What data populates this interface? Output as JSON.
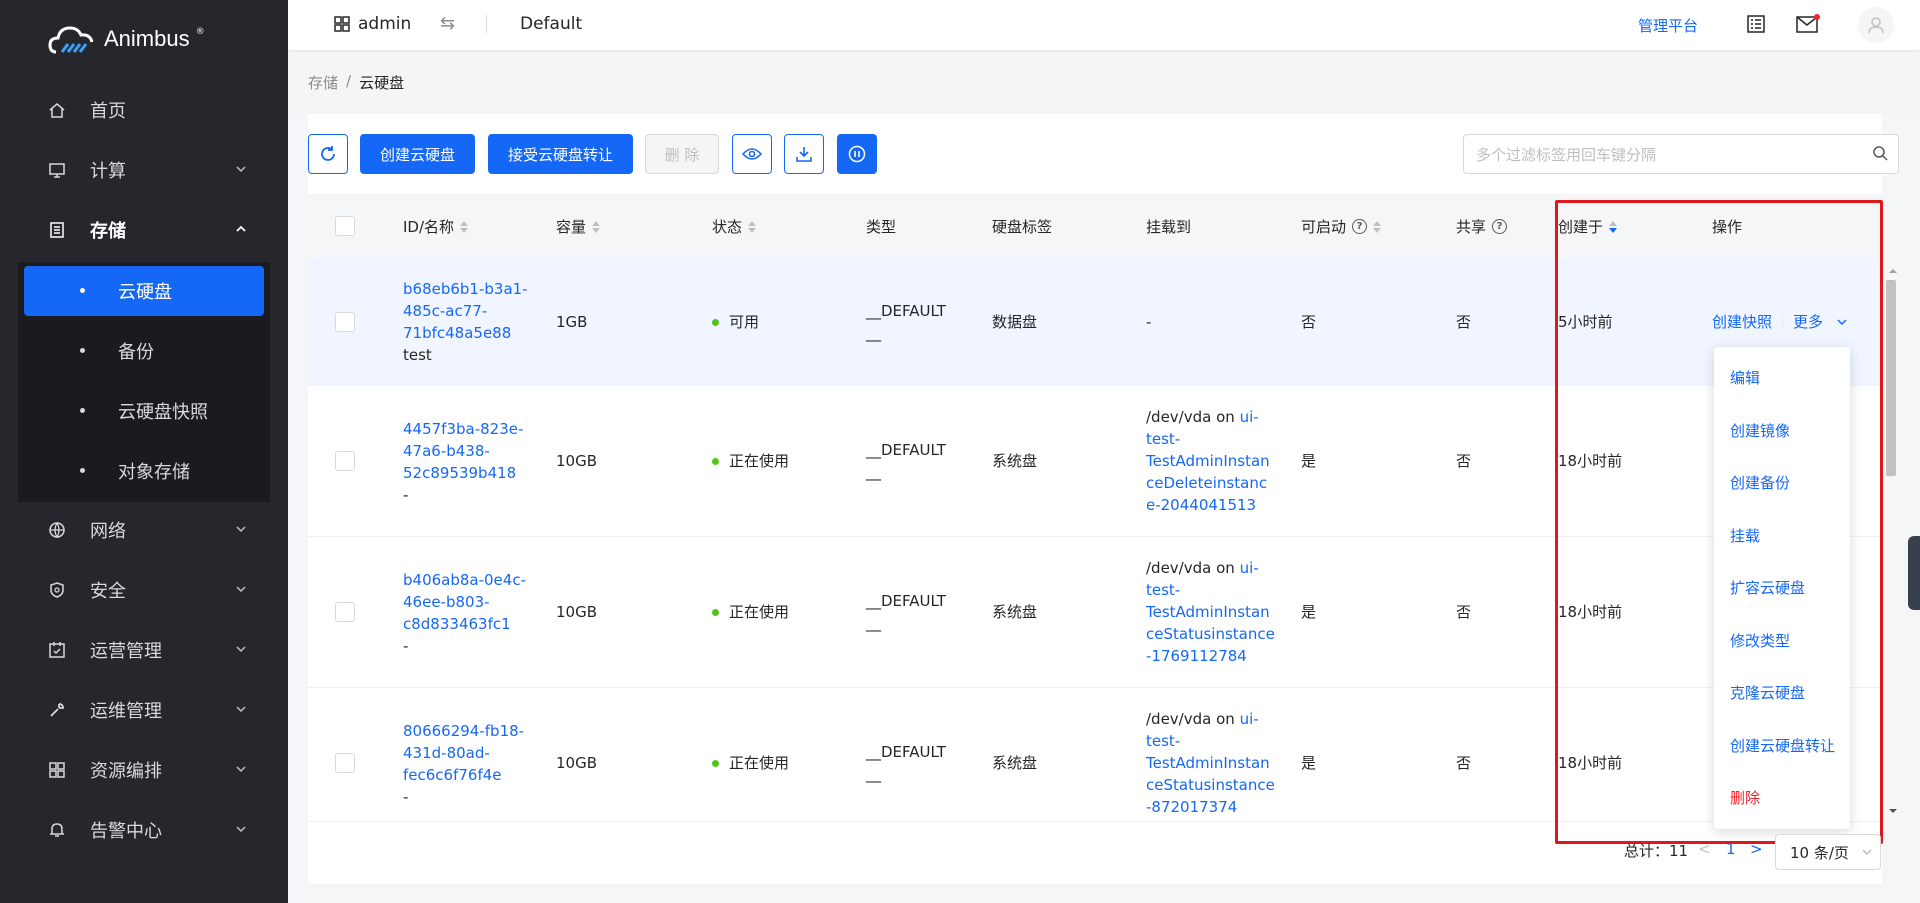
{
  "app": {
    "logo_text": "Animbus",
    "logo_mark": "®"
  },
  "sidebar": {
    "items": [
      {
        "label": "首页",
        "icon": "home-icon"
      },
      {
        "label": "计算",
        "icon": "monitor-icon"
      },
      {
        "label": "存储",
        "icon": "storage-icon"
      },
      {
        "label": "网络",
        "icon": "globe-icon"
      },
      {
        "label": "安全",
        "icon": "shield-icon"
      },
      {
        "label": "运营管理",
        "icon": "calendar-icon"
      },
      {
        "label": "运维管理",
        "icon": "wrench-icon"
      },
      {
        "label": "资源编排",
        "icon": "grid-icon"
      },
      {
        "label": "告警中心",
        "icon": "bell-icon"
      }
    ],
    "storage_sub": [
      {
        "label": "云硬盘"
      },
      {
        "label": "备份"
      },
      {
        "label": "云硬盘快照"
      },
      {
        "label": "对象存储"
      }
    ]
  },
  "header": {
    "project": "admin",
    "domain": "Default",
    "admin_link": "管理平台"
  },
  "breadcrumb": {
    "parent": "存储",
    "sep": "/",
    "current": "云硬盘"
  },
  "toolbar": {
    "create_label": "创建云硬盘",
    "accept_transfer_label": "接受云硬盘转让",
    "delete_label": "删 除",
    "search_placeholder": "多个过滤标签用回车键分隔"
  },
  "table": {
    "columns": {
      "id_name": "ID/名称",
      "size": "容量",
      "status": "状态",
      "type": "类型",
      "tag": "硬盘标签",
      "attached": "挂载到",
      "bootable": "可启动",
      "shared": "共享",
      "created": "创建于",
      "actions": "操作"
    },
    "rows": [
      {
        "id_lines": [
          "b68eb6b1-b3a1-",
          "485c-ac77-",
          "71bfc48a5e88"
        ],
        "name": "test",
        "size": "1GB",
        "status": "可用",
        "type_line1": "__DEFAULT",
        "type_line2": "__",
        "tag": "数据盘",
        "attached_dev": "-",
        "attached_lines": [],
        "bootable": "否",
        "shared": "否",
        "created": "5小时前",
        "action_snapshot": "创建快照",
        "action_more": "更多"
      },
      {
        "id_lines": [
          "4457f3ba-823e-",
          "47a6-b438-",
          "52c89539b418"
        ],
        "name": "-",
        "size": "10GB",
        "status": "正在使用",
        "type_line1": "__DEFAULT",
        "type_line2": "__",
        "tag": "系统盘",
        "attached_dev": "/dev/vda on",
        "attached_lines": [
          "ui-",
          "test-",
          "TestAdminInstan",
          "ceDeleteinstanc",
          "e-2044041513"
        ],
        "bootable": "是",
        "shared": "否",
        "created": "18小时前"
      },
      {
        "id_lines": [
          "b406ab8a-0e4c-",
          "46ee-b803-",
          "c8d833463fc1"
        ],
        "name": "-",
        "size": "10GB",
        "status": "正在使用",
        "type_line1": "__DEFAULT",
        "type_line2": "__",
        "tag": "系统盘",
        "attached_dev": "/dev/vda on",
        "attached_lines": [
          "ui-",
          "test-",
          "TestAdminInstan",
          "ceStatusinstance",
          "-1769112784"
        ],
        "bootable": "是",
        "shared": "否",
        "created": "18小时前"
      },
      {
        "id_lines": [
          "80666294-fb18-",
          "431d-80ad-",
          "fec6c6f76f4e"
        ],
        "name": "-",
        "size": "10GB",
        "status": "正在使用",
        "type_line1": "__DEFAULT",
        "type_line2": "__",
        "tag": "系统盘",
        "attached_dev": "/dev/vda on",
        "attached_lines": [
          "ui-",
          "test-",
          "TestAdminInstan",
          "ceStatusinstance",
          "-872017374"
        ],
        "bootable": "是",
        "shared": "否",
        "created": "18小时前"
      }
    ]
  },
  "dropdown": {
    "items": [
      "编辑",
      "创建镜像",
      "创建备份",
      "挂载",
      "扩容云硬盘",
      "修改类型",
      "克隆云硬盘",
      "创建云硬盘转让",
      "删除"
    ]
  },
  "pagination": {
    "total": "总计：11",
    "current_page": "1",
    "page_size": "10 条/页"
  },
  "colors": {
    "primary": "#1568f5",
    "sidebar_bg": "#25272d",
    "danger": "#f5222d",
    "success": "#52c41a",
    "highlight": "#e0181b"
  }
}
